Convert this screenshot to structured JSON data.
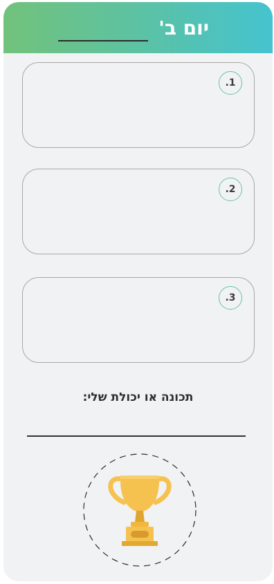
{
  "header": {
    "title": "יום ב'"
  },
  "boxes": [
    {
      "number": ".1"
    },
    {
      "number": ".2"
    },
    {
      "number": ".3"
    }
  ],
  "trait": {
    "label": "תכונה או יכולת שלי:"
  },
  "icons": {
    "trophy": "trophy-icon"
  },
  "colors": {
    "header_gradient_start": "#72c27b",
    "header_gradient_end": "#45c3cf",
    "circle_border": "#67c49b",
    "trophy_gold": "#f5c24f",
    "card_background": "#f1f2f4"
  }
}
